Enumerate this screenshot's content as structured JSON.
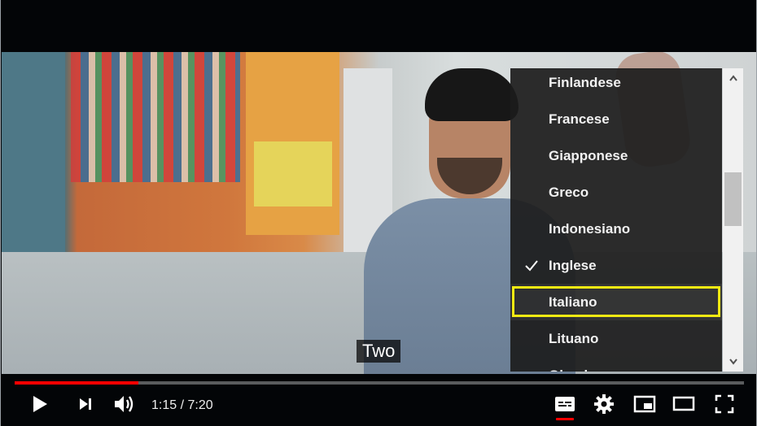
{
  "video": {
    "caption_text": "Two"
  },
  "subtitle_menu": {
    "items": [
      {
        "label": "Finlandese",
        "checked": false
      },
      {
        "label": "Francese",
        "checked": false
      },
      {
        "label": "Giapponese",
        "checked": false
      },
      {
        "label": "Greco",
        "checked": false
      },
      {
        "label": "Indonesiano",
        "checked": false
      },
      {
        "label": "Inglese",
        "checked": true
      },
      {
        "label": "Italiano",
        "checked": false,
        "highlighted": true
      },
      {
        "label": "Lituano",
        "checked": false
      },
      {
        "label": "Olandese",
        "checked": false
      }
    ],
    "check_icon": "checkmark-icon",
    "highlight_color": "#f3ea12"
  },
  "scrollbar": {
    "up_icon": "arrow-up-icon",
    "down_icon": "arrow-down-icon"
  },
  "progress": {
    "played_fraction": 0.17,
    "played_color": "#ff0000"
  },
  "controls": {
    "time_display": "1:15 / 7:20",
    "icons": [
      "play-icon",
      "next-icon",
      "volume-icon",
      "subtitles-icon",
      "settings-gear-icon",
      "miniplayer-icon",
      "theater-mode-icon",
      "fullscreen-icon"
    ]
  }
}
